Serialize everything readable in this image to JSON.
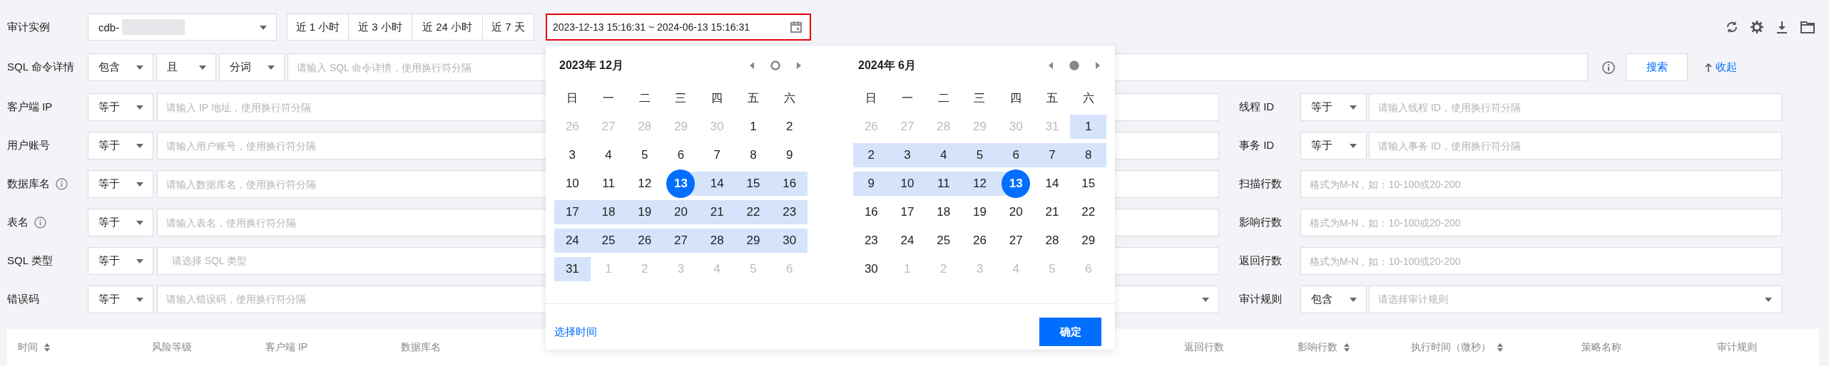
{
  "toolbar": {
    "instance_label": "审计实例",
    "instance_value": "cdb-",
    "quick_ranges": [
      {
        "label": "近 1 小时",
        "selected": false
      },
      {
        "label": "近 3 小时",
        "selected": false
      },
      {
        "label": "近 24 小时",
        "selected": false
      },
      {
        "label": "近 7 天",
        "selected": false
      }
    ],
    "date_range": "2023-12-13 15:16:31 ~ 2024-06-13 15:16:31"
  },
  "sql_filter": {
    "label": "SQL 命令详情",
    "operator": "包含",
    "logic": "且",
    "match_mode": "分词",
    "placeholder": "请输入 SQL 命令详情，使用换行符分隔",
    "search_button": "搜索",
    "collapse_link": "收起"
  },
  "left_filters": [
    {
      "label": "客户端 IP",
      "info": false,
      "operator": "等于",
      "placeholder": "请输入 IP 地址，使用换行符分隔",
      "kind": "text"
    },
    {
      "label": "用户账号",
      "info": false,
      "operator": "等于",
      "placeholder": "请输入用户账号，使用换行符分隔",
      "kind": "text"
    },
    {
      "label": "数据库名",
      "info": true,
      "operator": "等于",
      "placeholder": "请输入数据库名，使用换行符分隔",
      "kind": "text"
    },
    {
      "label": "表名",
      "info": true,
      "operator": "等于",
      "placeholder": "请输入表名，使用换行符分隔",
      "kind": "text"
    },
    {
      "label": "SQL 类型",
      "info": false,
      "operator": "等于",
      "placeholder": "请选择 SQL 类型",
      "kind": "tags"
    },
    {
      "label": "错误码",
      "info": false,
      "operator": "等于",
      "placeholder": "请输入错误码，使用换行符分隔",
      "kind": "select"
    }
  ],
  "right_filters": [
    {
      "label": "线程 ID",
      "operator": "等于",
      "placeholder": "请输入线程 ID，使用换行符分隔",
      "kind": "text"
    },
    {
      "label": "事务 ID",
      "operator": "等于",
      "placeholder": "请输入事务 ID，使用换行符分隔",
      "kind": "text"
    },
    {
      "label": "扫描行数",
      "placeholder": "格式为M-N，如：10-100或20-200",
      "kind": "range"
    },
    {
      "label": "影响行数",
      "placeholder": "格式为M-N，如：10-100或20-200",
      "kind": "range"
    },
    {
      "label": "返回行数",
      "placeholder": "格式为M-N，如：10-100或20-200",
      "kind": "range"
    },
    {
      "label": "审计规则",
      "operator": "包含",
      "placeholder": "请选择审计规则",
      "kind": "select"
    }
  ],
  "date_picker": {
    "calendars": [
      {
        "title": "2023年 12月",
        "dot_filled": false,
        "weekdays": [
          "日",
          "一",
          "二",
          "三",
          "四",
          "五",
          "六"
        ],
        "days": [
          {
            "day": "26",
            "outside": true,
            "in_range": false,
            "selected": false
          },
          {
            "day": "27",
            "outside": true,
            "in_range": false,
            "selected": false
          },
          {
            "day": "28",
            "outside": true,
            "in_range": false,
            "selected": false
          },
          {
            "day": "29",
            "outside": true,
            "in_range": false,
            "selected": false
          },
          {
            "day": "30",
            "outside": true,
            "in_range": false,
            "selected": false
          },
          {
            "day": "1",
            "outside": false,
            "in_range": false,
            "selected": false
          },
          {
            "day": "2",
            "outside": false,
            "in_range": false,
            "selected": false
          },
          {
            "day": "3",
            "outside": false,
            "in_range": false,
            "selected": false
          },
          {
            "day": "4",
            "outside": false,
            "in_range": false,
            "selected": false
          },
          {
            "day": "5",
            "outside": false,
            "in_range": false,
            "selected": false
          },
          {
            "day": "6",
            "outside": false,
            "in_range": false,
            "selected": false
          },
          {
            "day": "7",
            "outside": false,
            "in_range": false,
            "selected": false
          },
          {
            "day": "8",
            "outside": false,
            "in_range": false,
            "selected": false
          },
          {
            "day": "9",
            "outside": false,
            "in_range": false,
            "selected": false
          },
          {
            "day": "10",
            "outside": false,
            "in_range": false,
            "selected": false
          },
          {
            "day": "11",
            "outside": false,
            "in_range": false,
            "selected": false
          },
          {
            "day": "12",
            "outside": false,
            "in_range": false,
            "selected": false
          },
          {
            "day": "13",
            "outside": false,
            "in_range": false,
            "selected": true
          },
          {
            "day": "14",
            "outside": false,
            "in_range": true,
            "selected": false
          },
          {
            "day": "15",
            "outside": false,
            "in_range": true,
            "selected": false
          },
          {
            "day": "16",
            "outside": false,
            "in_range": true,
            "selected": false
          },
          {
            "day": "17",
            "outside": false,
            "in_range": true,
            "selected": false
          },
          {
            "day": "18",
            "outside": false,
            "in_range": true,
            "selected": false
          },
          {
            "day": "19",
            "outside": false,
            "in_range": true,
            "selected": false
          },
          {
            "day": "20",
            "outside": false,
            "in_range": true,
            "selected": false
          },
          {
            "day": "21",
            "outside": false,
            "in_range": true,
            "selected": false
          },
          {
            "day": "22",
            "outside": false,
            "in_range": true,
            "selected": false
          },
          {
            "day": "23",
            "outside": false,
            "in_range": true,
            "selected": false
          },
          {
            "day": "24",
            "outside": false,
            "in_range": true,
            "selected": false
          },
          {
            "day": "25",
            "outside": false,
            "in_range": true,
            "selected": false
          },
          {
            "day": "26",
            "outside": false,
            "in_range": true,
            "selected": false
          },
          {
            "day": "27",
            "outside": false,
            "in_range": true,
            "selected": false
          },
          {
            "day": "28",
            "outside": false,
            "in_range": true,
            "selected": false
          },
          {
            "day": "29",
            "outside": false,
            "in_range": true,
            "selected": false
          },
          {
            "day": "30",
            "outside": false,
            "in_range": true,
            "selected": false
          },
          {
            "day": "31",
            "outside": false,
            "in_range": true,
            "selected": false
          },
          {
            "day": "1",
            "outside": true,
            "in_range": false,
            "selected": false
          },
          {
            "day": "2",
            "outside": true,
            "in_range": false,
            "selected": false
          },
          {
            "day": "3",
            "outside": true,
            "in_range": false,
            "selected": false
          },
          {
            "day": "4",
            "outside": true,
            "in_range": false,
            "selected": false
          },
          {
            "day": "5",
            "outside": true,
            "in_range": false,
            "selected": false
          },
          {
            "day": "6",
            "outside": true,
            "in_range": false,
            "selected": false
          }
        ]
      },
      {
        "title": "2024年 6月",
        "dot_filled": true,
        "weekdays": [
          "日",
          "一",
          "二",
          "三",
          "四",
          "五",
          "六"
        ],
        "days": [
          {
            "day": "26",
            "outside": true,
            "in_range": false,
            "selected": false
          },
          {
            "day": "27",
            "outside": true,
            "in_range": false,
            "selected": false
          },
          {
            "day": "28",
            "outside": true,
            "in_range": false,
            "selected": false
          },
          {
            "day": "29",
            "outside": true,
            "in_range": false,
            "selected": false
          },
          {
            "day": "30",
            "outside": true,
            "in_range": false,
            "selected": false
          },
          {
            "day": "31",
            "outside": true,
            "in_range": false,
            "selected": false
          },
          {
            "day": "1",
            "outside": false,
            "in_range": true,
            "selected": false
          },
          {
            "day": "2",
            "outside": false,
            "in_range": true,
            "selected": false
          },
          {
            "day": "3",
            "outside": false,
            "in_range": true,
            "selected": false
          },
          {
            "day": "4",
            "outside": false,
            "in_range": true,
            "selected": false
          },
          {
            "day": "5",
            "outside": false,
            "in_range": true,
            "selected": false
          },
          {
            "day": "6",
            "outside": false,
            "in_range": true,
            "selected": false
          },
          {
            "day": "7",
            "outside": false,
            "in_range": true,
            "selected": false
          },
          {
            "day": "8",
            "outside": false,
            "in_range": true,
            "selected": false
          },
          {
            "day": "9",
            "outside": false,
            "in_range": true,
            "selected": false
          },
          {
            "day": "10",
            "outside": false,
            "in_range": true,
            "selected": false
          },
          {
            "day": "11",
            "outside": false,
            "in_range": true,
            "selected": false
          },
          {
            "day": "12",
            "outside": false,
            "in_range": true,
            "selected": false
          },
          {
            "day": "13",
            "outside": false,
            "in_range": false,
            "selected": true
          },
          {
            "day": "14",
            "outside": false,
            "in_range": false,
            "selected": false
          },
          {
            "day": "15",
            "outside": false,
            "in_range": false,
            "selected": false
          },
          {
            "day": "16",
            "outside": false,
            "in_range": false,
            "selected": false
          },
          {
            "day": "17",
            "outside": false,
            "in_range": false,
            "selected": false
          },
          {
            "day": "18",
            "outside": false,
            "in_range": false,
            "selected": false
          },
          {
            "day": "19",
            "outside": false,
            "in_range": false,
            "selected": false
          },
          {
            "day": "20",
            "outside": false,
            "in_range": false,
            "selected": false
          },
          {
            "day": "21",
            "outside": false,
            "in_range": false,
            "selected": false
          },
          {
            "day": "22",
            "outside": false,
            "in_range": false,
            "selected": false
          },
          {
            "day": "23",
            "outside": false,
            "in_range": false,
            "selected": false
          },
          {
            "day": "24",
            "outside": false,
            "in_range": false,
            "selected": false
          },
          {
            "day": "25",
            "outside": false,
            "in_range": false,
            "selected": false
          },
          {
            "day": "26",
            "outside": false,
            "in_range": false,
            "selected": false
          },
          {
            "day": "27",
            "outside": false,
            "in_range": false,
            "selected": false
          },
          {
            "day": "28",
            "outside": false,
            "in_range": false,
            "selected": false
          },
          {
            "day": "29",
            "outside": false,
            "in_range": false,
            "selected": false
          },
          {
            "day": "30",
            "outside": false,
            "in_range": false,
            "selected": false
          },
          {
            "day": "1",
            "outside": true,
            "in_range": false,
            "selected": false
          },
          {
            "day": "2",
            "outside": true,
            "in_range": false,
            "selected": false
          },
          {
            "day": "3",
            "outside": true,
            "in_range": false,
            "selected": false
          },
          {
            "day": "4",
            "outside": true,
            "in_range": false,
            "selected": false
          },
          {
            "day": "5",
            "outside": true,
            "in_range": false,
            "selected": false
          },
          {
            "day": "6",
            "outside": true,
            "in_range": false,
            "selected": false
          }
        ]
      }
    ],
    "footer_link": "选择时间",
    "confirm_button": "确定"
  },
  "table": {
    "columns": [
      {
        "label": "时间",
        "sortable": true
      },
      {
        "label": "风险等级",
        "sortable": false
      },
      {
        "label": "客户端 IP",
        "sortable": false
      },
      {
        "label": "数据库名",
        "sortable": false
      },
      {
        "label": "返回行数",
        "sortable": false
      },
      {
        "label": "影响行数",
        "sortable": true
      },
      {
        "label": "执行时间（微秒）",
        "sortable": true
      },
      {
        "label": "策略名称",
        "sortable": false
      },
      {
        "label": "审计规则",
        "sortable": false
      }
    ]
  }
}
